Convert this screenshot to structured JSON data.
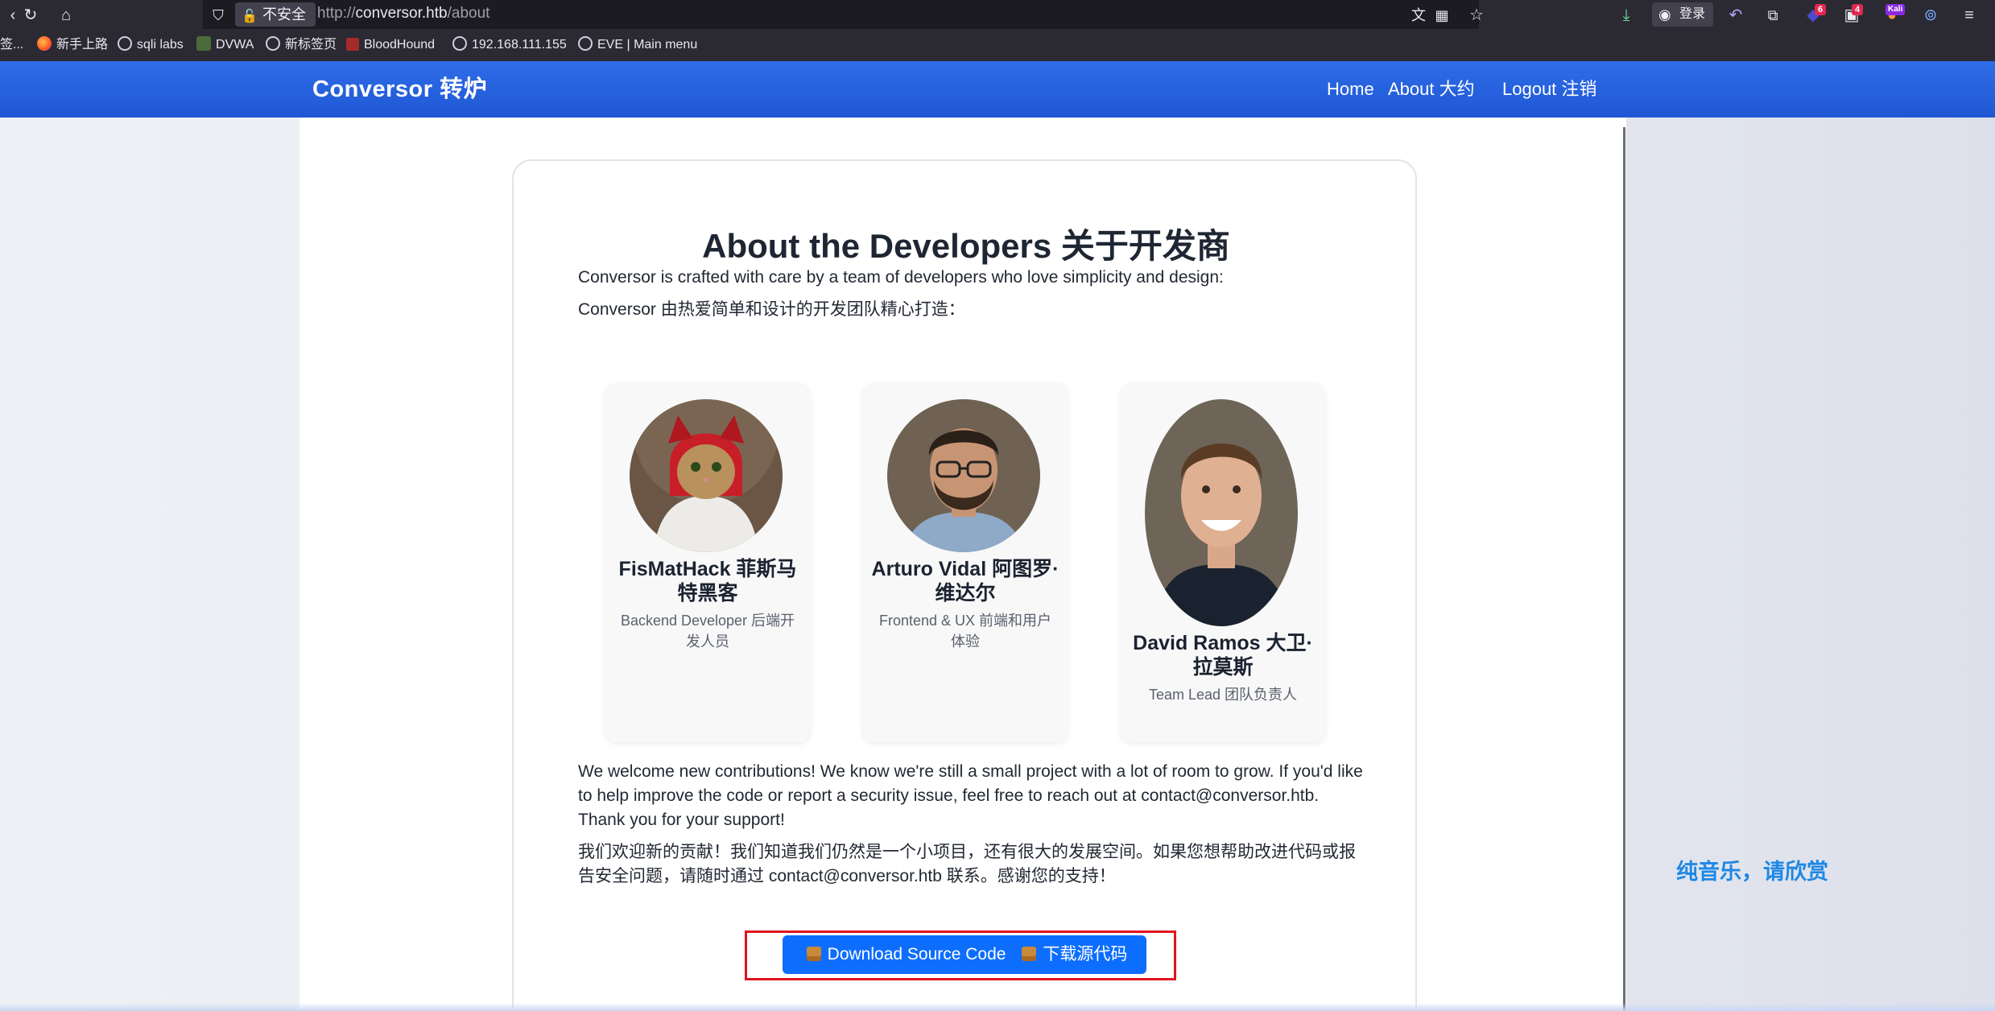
{
  "browser": {
    "security_label": "不安全",
    "url_prefix": "http://",
    "url_host": "conversor.htb",
    "url_path": "/about",
    "login_label": "登录",
    "badges": {
      "ext1": "6",
      "ext2": "4",
      "kali": "Kali"
    }
  },
  "bookmarks": [
    {
      "label": "签..."
    },
    {
      "label": "新手上路"
    },
    {
      "label": "sqli labs"
    },
    {
      "label": "DVWA"
    },
    {
      "label": "新标签页"
    },
    {
      "label": "BloodHound"
    },
    {
      "label": "192.168.111.155"
    },
    {
      "label": "EVE | Main menu"
    }
  ],
  "site": {
    "brand": "Conversor 转炉",
    "nav": {
      "home": "Home",
      "about": "About 大约",
      "logout": "Logout 注销"
    }
  },
  "about": {
    "title": "About the Developers 关于开发商",
    "intro_en": "Conversor is crafted with care by a team of developers who love simplicity and design:",
    "intro_zh": "Conversor 由热爱简单和设计的开发团队精心打造：",
    "developers": [
      {
        "name": "FisMatHack 菲斯马特黑客",
        "role": "Backend Developer 后端开发人员"
      },
      {
        "name": "Arturo Vidal 阿图罗·维达尔",
        "role": "Frontend & UX 前端和用户体验"
      },
      {
        "name": "David Ramos 大卫·拉莫斯",
        "role": "Team Lead 团队负责人"
      }
    ],
    "welcome_en": "We welcome new contributions! We know we're still a small project with a lot of room to grow. If you'd like to help improve the code or report a security issue, feel free to reach out at contact@conversor.htb. Thank you for your support!",
    "welcome_zh": "我们欢迎新的贡献！我们知道我们仍然是一个小项目，还有很大的发展空间。如果您想帮助改进代码或报告安全问题，请随时通过 contact@conversor.htb 联系。感谢您的支持！",
    "download_en": "Download Source Code",
    "download_zh": "下载源代码"
  },
  "side_text": "纯音乐，请欣赏",
  "colors": {
    "nav": "#1f57d4",
    "button": "#0d6efd",
    "highlight": "#e0141e",
    "side_text": "#1e88e5"
  }
}
